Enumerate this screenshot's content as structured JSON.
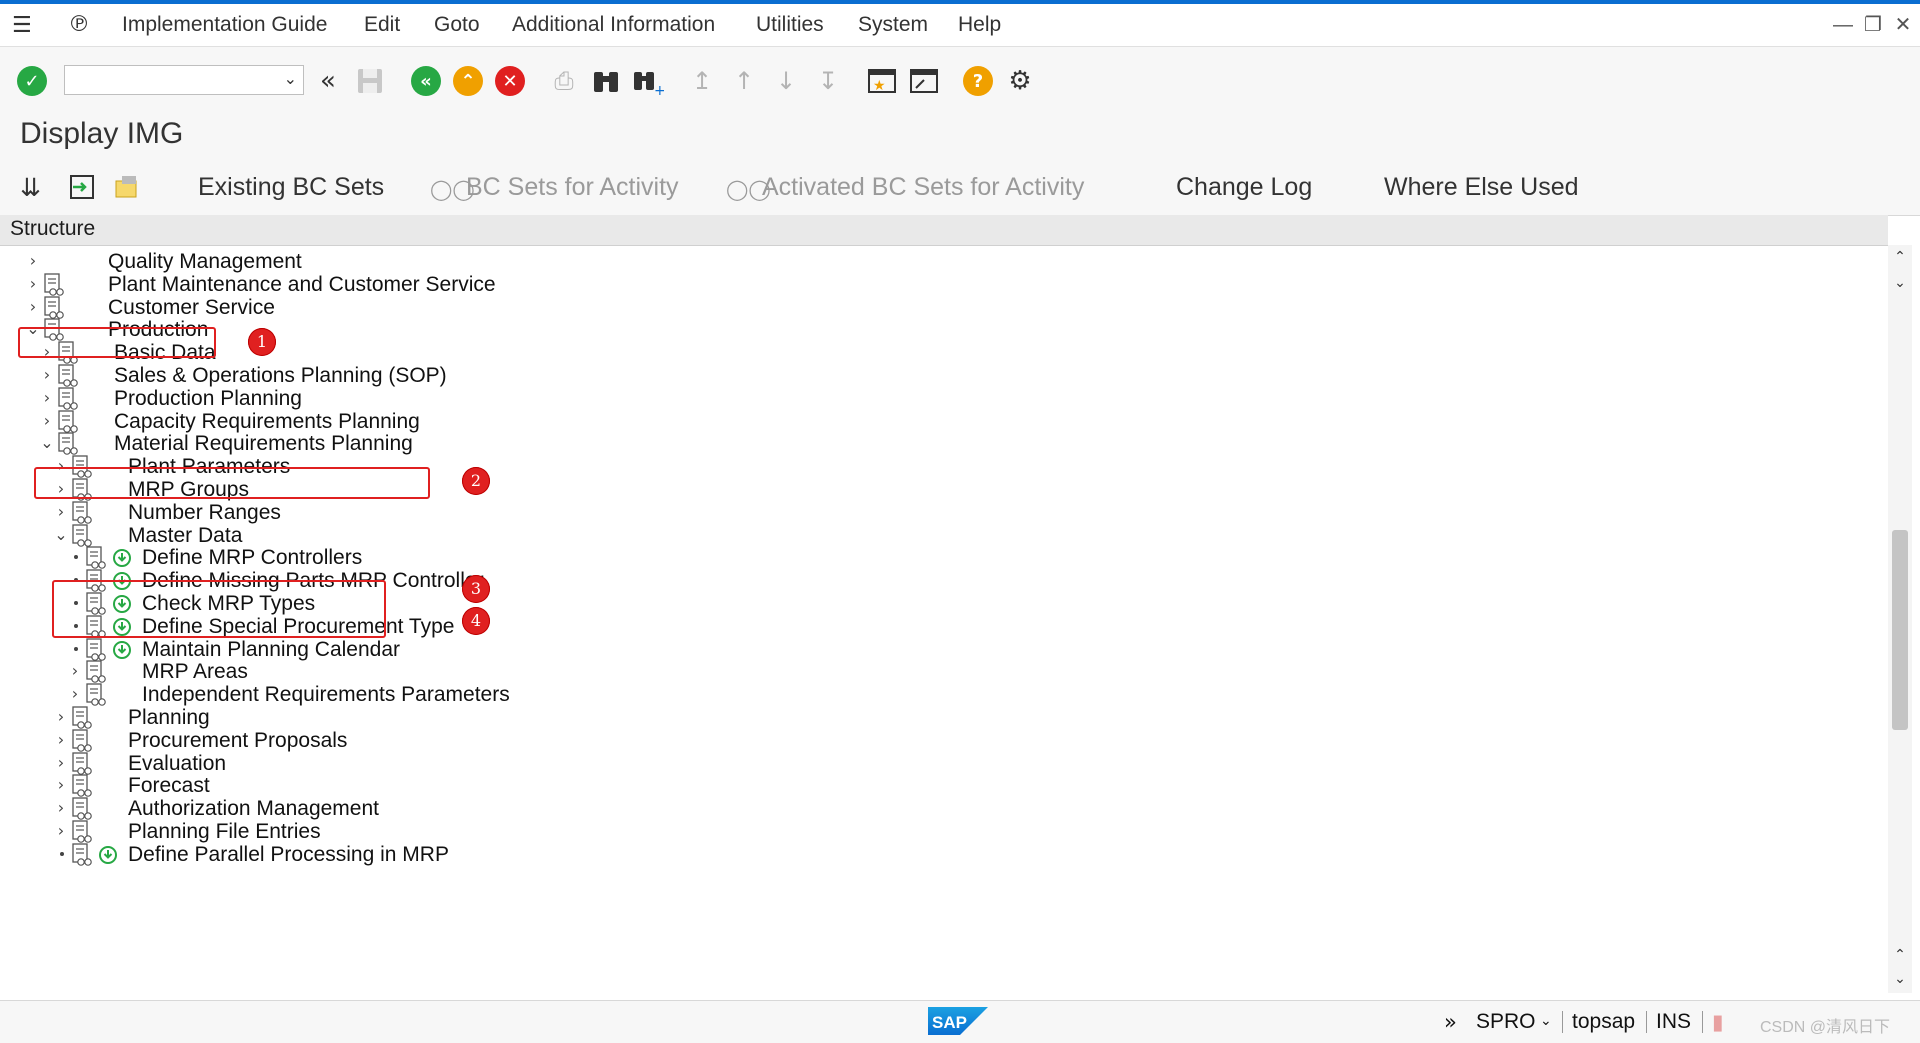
{
  "menu": {
    "items": [
      "Implementation Guide",
      "Edit",
      "Goto",
      "Additional Information",
      "Utilities",
      "System",
      "Help"
    ]
  },
  "toolbar": {
    "command_field_value": "",
    "icons": [
      "enter-icon",
      "back-double-icon",
      "save-icon",
      "back-icon",
      "exit-icon",
      "cancel-icon",
      "print-icon",
      "find-icon",
      "find-next-icon",
      "first-page-icon",
      "prev-page-icon",
      "next-page-icon",
      "last-page-icon",
      "create-session-icon",
      "shortcut-icon",
      "help-icon",
      "customize-layout-icon"
    ]
  },
  "page": {
    "title": "Display IMG"
  },
  "app_toolbar": {
    "existing_bc_sets": "Existing BC Sets",
    "bc_sets_for_activity": "BC Sets for Activity",
    "activated_bc_sets": "Activated BC Sets for Activity",
    "change_log": "Change Log",
    "where_else_used": "Where Else Used"
  },
  "structure": {
    "header": "Structure",
    "nodes": [
      {
        "label": "Quality Management",
        "level": 0,
        "state": "collapsed",
        "doc": false,
        "exec": false
      },
      {
        "label": "Plant Maintenance and Customer Service",
        "level": 0,
        "state": "collapsed",
        "doc": true,
        "exec": false
      },
      {
        "label": "Customer Service",
        "level": 0,
        "state": "collapsed",
        "doc": true,
        "exec": false
      },
      {
        "label": "Production",
        "level": 0,
        "state": "expanded",
        "doc": true,
        "exec": false
      },
      {
        "label": "Basic Data",
        "level": 1,
        "state": "collapsed",
        "doc": true,
        "exec": false
      },
      {
        "label": "Sales & Operations Planning (SOP)",
        "level": 1,
        "state": "collapsed",
        "doc": true,
        "exec": false
      },
      {
        "label": "Production Planning",
        "level": 1,
        "state": "collapsed",
        "doc": true,
        "exec": false
      },
      {
        "label": "Capacity Requirements Planning",
        "level": 1,
        "state": "collapsed",
        "doc": true,
        "exec": false
      },
      {
        "label": "Material Requirements Planning",
        "level": 1,
        "state": "expanded",
        "doc": true,
        "exec": false
      },
      {
        "label": "Plant Parameters",
        "level": 2,
        "state": "collapsed",
        "doc": true,
        "exec": false
      },
      {
        "label": "MRP Groups",
        "level": 2,
        "state": "collapsed",
        "doc": true,
        "exec": false
      },
      {
        "label": "Number Ranges",
        "level": 2,
        "state": "collapsed",
        "doc": true,
        "exec": false
      },
      {
        "label": "Master Data",
        "level": 2,
        "state": "expanded",
        "doc": true,
        "exec": false
      },
      {
        "label": "Define MRP Controllers",
        "level": 3,
        "state": "leaf",
        "doc": true,
        "exec": true
      },
      {
        "label": "Define Missing Parts MRP Controller",
        "level": 3,
        "state": "leaf",
        "doc": true,
        "exec": true
      },
      {
        "label": "Check MRP Types",
        "level": 3,
        "state": "leaf",
        "doc": true,
        "exec": true
      },
      {
        "label": "Define Special Procurement Type",
        "level": 3,
        "state": "leaf",
        "doc": true,
        "exec": true
      },
      {
        "label": "Maintain Planning Calendar",
        "level": 3,
        "state": "leaf",
        "doc": true,
        "exec": true
      },
      {
        "label": "MRP Areas",
        "level": 3,
        "state": "collapsed",
        "doc": true,
        "exec": false
      },
      {
        "label": "Independent Requirements Parameters",
        "level": 3,
        "state": "collapsed",
        "doc": true,
        "exec": false
      },
      {
        "label": "Planning",
        "level": 2,
        "state": "collapsed",
        "doc": true,
        "exec": false
      },
      {
        "label": "Procurement Proposals",
        "level": 2,
        "state": "collapsed",
        "doc": true,
        "exec": false
      },
      {
        "label": "Evaluation",
        "level": 2,
        "state": "collapsed",
        "doc": true,
        "exec": false
      },
      {
        "label": "Forecast",
        "level": 2,
        "state": "collapsed",
        "doc": true,
        "exec": false
      },
      {
        "label": "Authorization Management",
        "level": 2,
        "state": "collapsed",
        "doc": true,
        "exec": false
      },
      {
        "label": "Planning File Entries",
        "level": 2,
        "state": "collapsed",
        "doc": true,
        "exec": false
      },
      {
        "label": "Define Parallel Processing in MRP",
        "level": 2,
        "state": "leaf",
        "doc": true,
        "exec": true
      }
    ]
  },
  "annotations": [
    "1",
    "2",
    "3",
    "4"
  ],
  "status": {
    "expand": "»",
    "transaction": "SPRO",
    "server": "topsap",
    "mode": "INS",
    "watermark": "CSDN @清风日下"
  },
  "colors": {
    "accent": "#0a6ed1",
    "highlight": "#e02020",
    "ok_green": "#27a844",
    "nav_orange": "#f0a000",
    "cancel_red": "#e02020"
  }
}
